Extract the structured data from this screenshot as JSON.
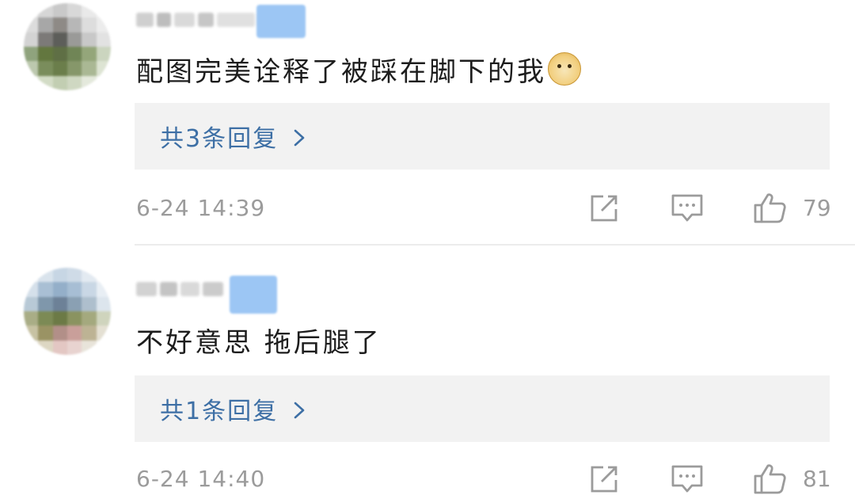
{
  "comments": [
    {
      "text": "配图完美诠释了被踩在脚下的我",
      "emoji_icon": "doge-face-icon",
      "replies_label": "共3条回复",
      "timestamp": "6-24 14:39",
      "like_count": "79"
    },
    {
      "text": "不好意思 拖后腿了",
      "replies_label": "共1条回复",
      "timestamp": "6-24 14:40",
      "like_count": "81"
    }
  ],
  "icons": {
    "share": "share-icon",
    "reply": "comment-icon",
    "like": "thumbs-up-icon",
    "chevron": "chevron-right-icon"
  },
  "colors": {
    "link": "#3d6fa5",
    "muted": "#9b9b9b",
    "reply_box": "#f2f2f2",
    "badge": "#9cc6f4"
  }
}
